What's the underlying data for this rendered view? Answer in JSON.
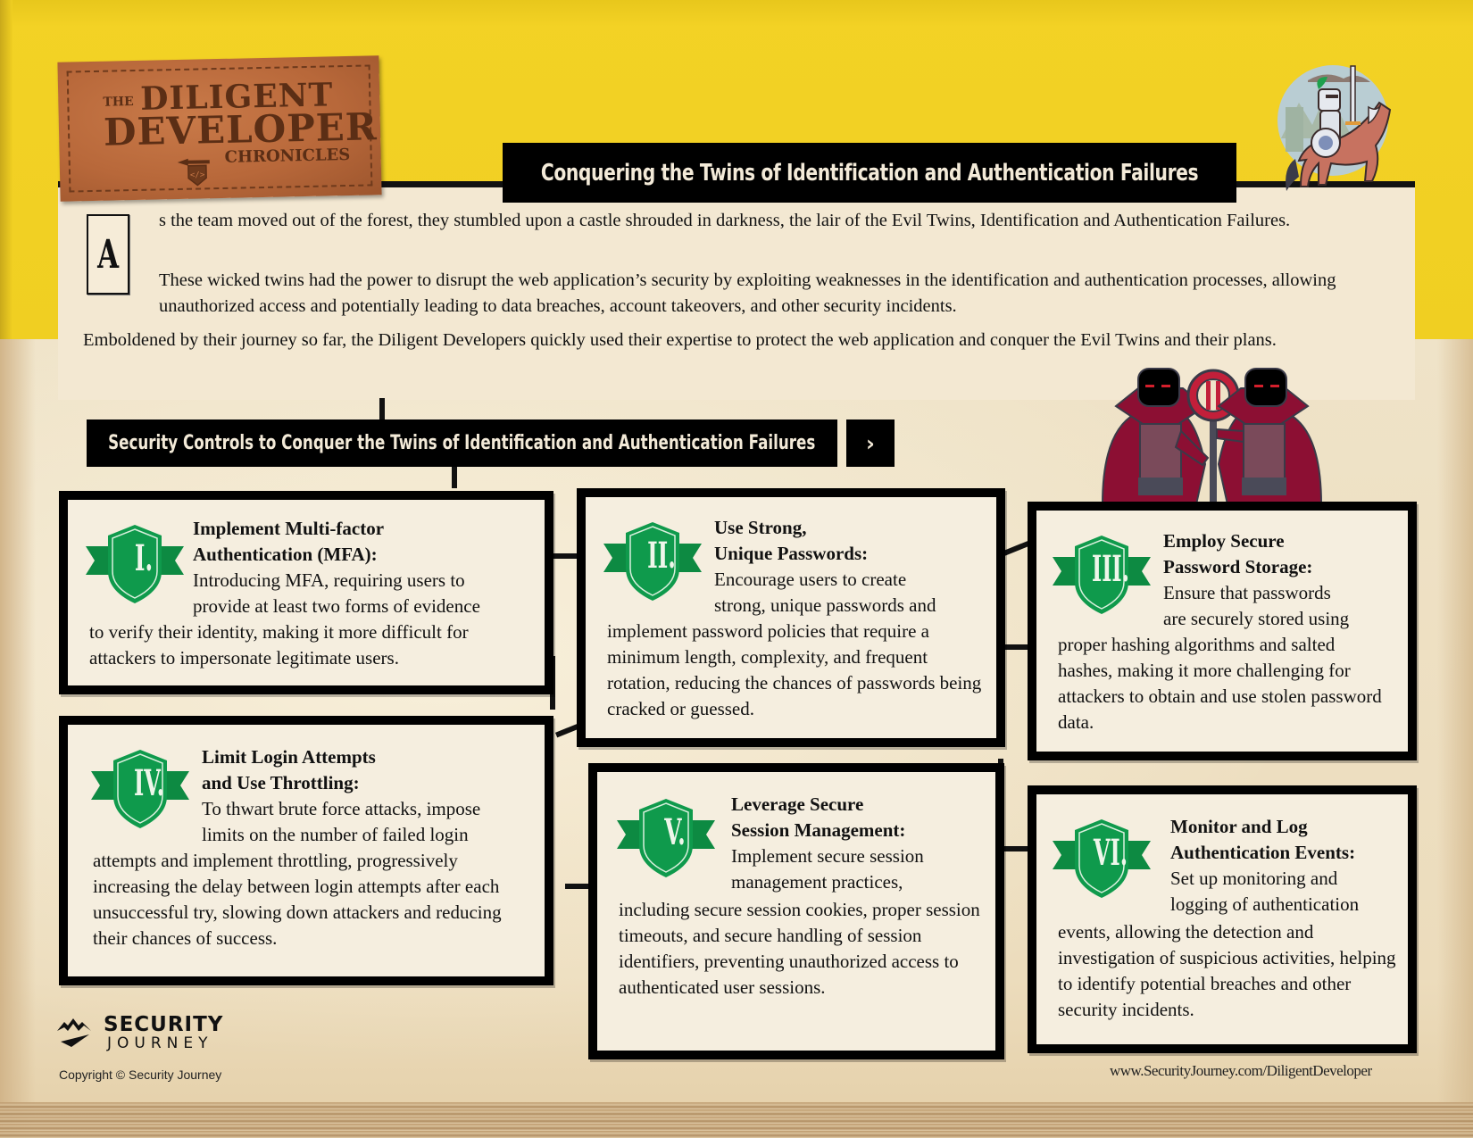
{
  "logo": {
    "the": "THE",
    "diligent": "DILIGENT",
    "developer": "DEVELOPER",
    "chronicles": "CHRONICLES",
    "emblem_icon": "code-brackets-icon"
  },
  "header": {
    "title": "Conquering the Twins of Identification and Authentication Failures"
  },
  "intro": {
    "drop_cap": "A",
    "paragraph_1": "s the team moved out of the forest, they stumbled upon a castle shrouded in darkness, the lair of the Evil Twins, Identification and Authentication Failures.",
    "paragraph_2": "These wicked twins had the power to disrupt the web application’s security by exploiting weaknesses in the identification and authentication processes, allowing unauthorized access and potentially leading to data breaches, account takeovers, and other security incidents.",
    "paragraph_3": "Emboldened by their journey so far, the Diligent Developers quickly used their expertise to protect the web application and conquer the Evil Twins and their plans."
  },
  "section": {
    "title": "Security Controls to Conquer the Twins of Identification and Authentication Failures",
    "next_label": "›"
  },
  "colors": {
    "yellow": "#f3d225",
    "badge_green": "#0f9a4c",
    "banner_black": "#000000",
    "paper": "#f5eedf",
    "cape_red": "#8c0f33"
  },
  "controls": [
    {
      "numeral": "I.",
      "title_line_1": "Implement Multi-factor",
      "title_line_2": "Authentication (MFA):",
      "body_indent": [
        "Introducing MFA, requiring users to",
        "provide at least two forms of evidence"
      ],
      "body_rest": "to verify their identity, making it more difficult for attackers to impersonate legitimate users."
    },
    {
      "numeral": "II.",
      "title_line_1": "Use Strong,",
      "title_line_2": "Unique Passwords:",
      "body_indent": [
        "Encourage users to create",
        "strong, unique passwords and"
      ],
      "body_rest": "implement password policies that require a minimum length, complexity, and frequent rotation, reducing the chances of passwords being cracked or guessed."
    },
    {
      "numeral": "III.",
      "title_line_1": "Employ Secure",
      "title_line_2": "Password Storage:",
      "body_indent": [
        "Ensure that passwords",
        "are securely stored using"
      ],
      "body_rest": "proper hashing algorithms and salted hashes, making it more challenging for attackers to obtain and use stolen password data."
    },
    {
      "numeral": "IV.",
      "title_line_1": "Limit Login Attempts",
      "title_line_2": "and Use Throttling:",
      "body_indent": [
        "To thwart brute force attacks, impose",
        "limits on the number of failed login"
      ],
      "body_rest": "attempts and implement throttling, progressively increasing the delay between login attempts after each unsuccessful try, slowing down attackers and reducing their chances of success."
    },
    {
      "numeral": "V.",
      "title_line_1": "Leverage Secure",
      "title_line_2": "Session Management:",
      "body_indent": [
        "Implement secure session",
        "management practices,"
      ],
      "body_rest": "including secure session cookies, proper session timeouts, and secure handling of session identifiers, preventing unauthorized access to authenticated user sessions."
    },
    {
      "numeral": "VI.",
      "title_line_1": "Monitor and Log",
      "title_line_2": "Authentication Events:",
      "body_indent": [
        "Set up monitoring and",
        "logging of authentication"
      ],
      "body_rest": "events, allowing the detection and investigation of suspicious activities, helping to identify potential breaches and other security incidents."
    }
  ],
  "footer": {
    "brand_top": "SECURITY",
    "brand_bottom": "JOURNEY",
    "copyright": "Copyright © Security Journey",
    "url": "www.SecurityJourney.com/DiligentDeveloper"
  }
}
